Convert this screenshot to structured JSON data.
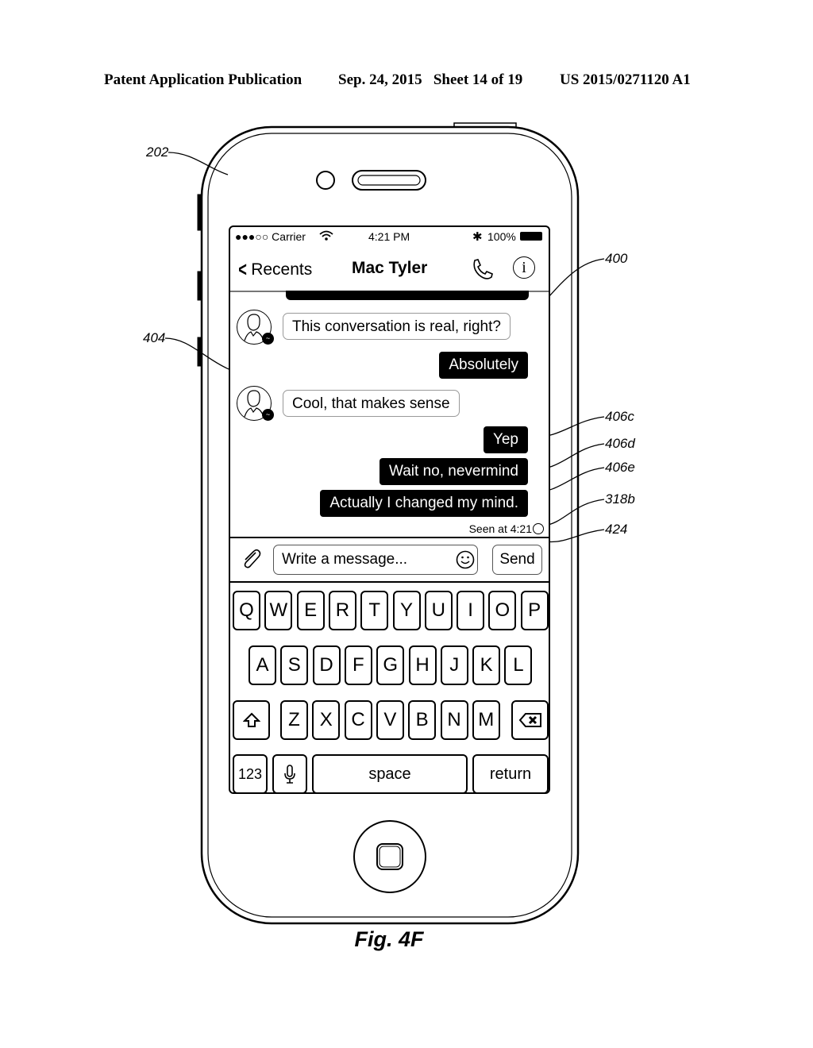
{
  "patent_header": {
    "publication": "Patent Application Publication",
    "date_sheet": "Sep. 24, 2015   Sheet 14 of 19",
    "number": "US 2015/0271120 A1"
  },
  "reference_labels": {
    "device": "202",
    "conversation": "400",
    "gap": "404",
    "msg_c": "406c",
    "msg_d": "406d",
    "msg_e": "406e",
    "read_receipt": "318b",
    "seen_indicator": "424"
  },
  "status_bar": {
    "carrier": "●●●○○ Carrier",
    "time": "4:21 PM",
    "battery": "100%"
  },
  "nav": {
    "back_label": "Recents",
    "title": "Mac Tyler"
  },
  "messages": [
    {
      "direction": "incoming",
      "text": "This conversation is real, right?"
    },
    {
      "direction": "outgoing",
      "text": "Absolutely"
    },
    {
      "direction": "incoming",
      "text": "Cool, that makes sense"
    },
    {
      "direction": "outgoing",
      "text": "Yep"
    },
    {
      "direction": "outgoing",
      "text": "Wait no, nevermind"
    },
    {
      "direction": "outgoing",
      "text": "Actually I changed my mind."
    }
  ],
  "seen_text": "Seen at 4:21",
  "composer": {
    "placeholder": "Write a message...",
    "send_label": "Send"
  },
  "keyboard": {
    "row1": [
      "Q",
      "W",
      "E",
      "R",
      "T",
      "Y",
      "U",
      "I",
      "O",
      "P"
    ],
    "row2": [
      "A",
      "S",
      "D",
      "F",
      "G",
      "H",
      "J",
      "K",
      "L"
    ],
    "row3": [
      "Z",
      "X",
      "C",
      "V",
      "B",
      "N",
      "M"
    ],
    "numbers_label": "123",
    "space_label": "space",
    "return_label": "return"
  },
  "figure_caption": "Fig. 4F"
}
